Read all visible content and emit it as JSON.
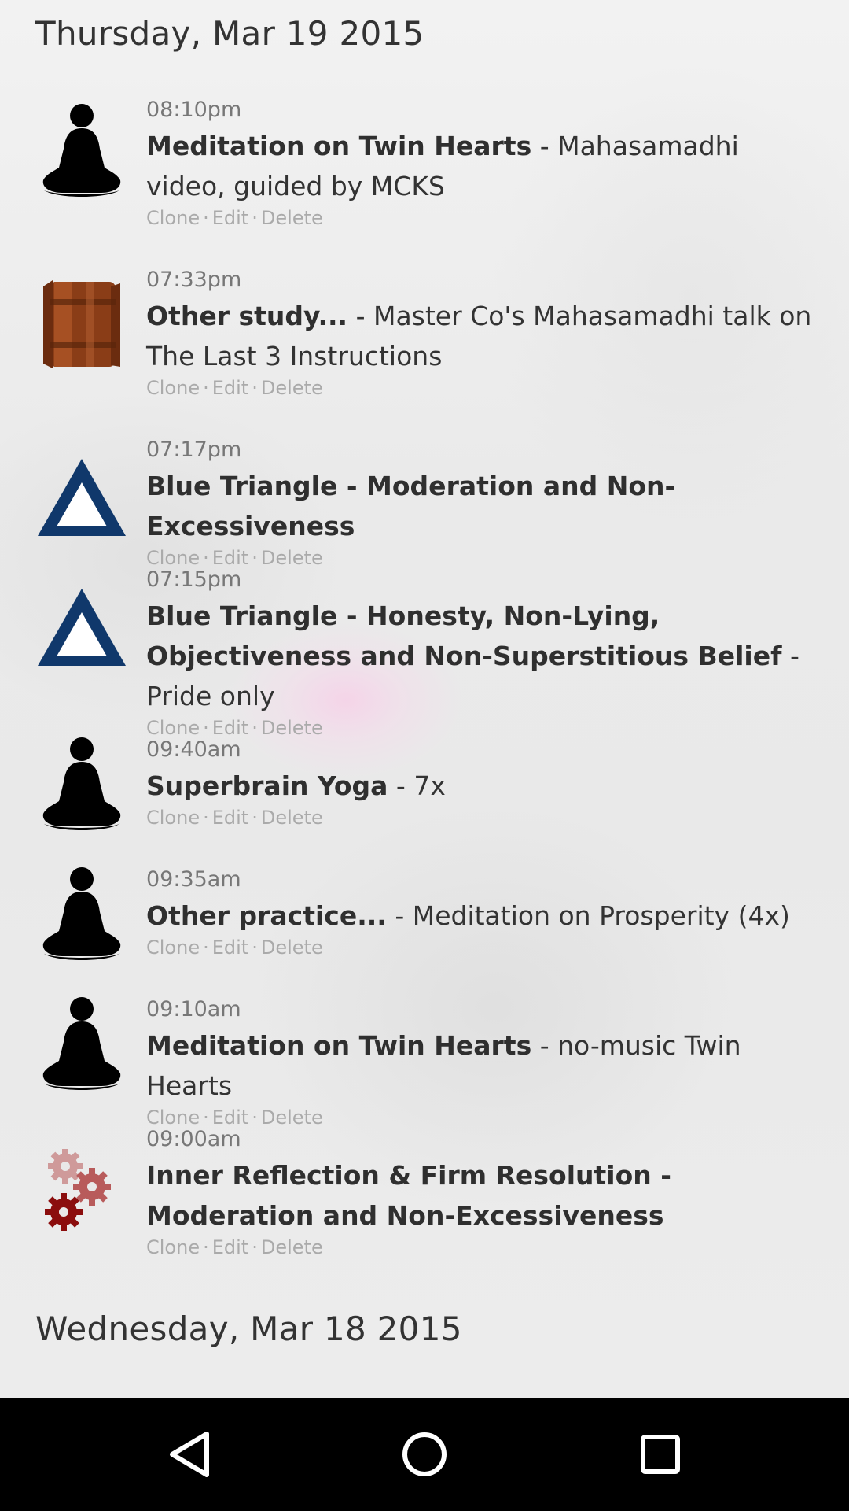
{
  "days": [
    {
      "label": "Thursday, Mar 19 2015"
    },
    {
      "label": "Wednesday, Mar 18 2015"
    }
  ],
  "entries": [
    {
      "time": "08:10pm",
      "name": "Meditation on Twin Hearts",
      "detail": " - Mahasamadhi video, guided by MCKS",
      "icon": "meditation-figure-icon"
    },
    {
      "time": "07:33pm",
      "name": "Other study...",
      "detail": " - Master Co's Mahasamadhi talk on The Last 3 Instructions",
      "icon": "book-scroll-icon"
    },
    {
      "time": "07:17pm",
      "name": "Blue Triangle - Moderation and Non-Excessiveness",
      "detail": "",
      "icon": "blue-triangle-icon"
    },
    {
      "time": "07:15pm",
      "name": "Blue Triangle - Honesty, Non-Lying, Objectiveness and Non-Superstitious Belief",
      "detail": " - Pride only",
      "icon": "blue-triangle-icon"
    },
    {
      "time": "09:40am",
      "name": "Superbrain Yoga",
      "detail": " - 7x",
      "icon": "meditation-figure-icon"
    },
    {
      "time": "09:35am",
      "name": "Other practice...",
      "detail": " - Meditation on Prosperity (4x)",
      "icon": "meditation-figure-icon"
    },
    {
      "time": "09:10am",
      "name": "Meditation on Twin Hearts",
      "detail": " - no-music Twin Hearts",
      "icon": "meditation-figure-icon"
    },
    {
      "time": "09:00am",
      "name": "Inner Reflection & Firm Resolution - Moderation and Non-Excessiveness",
      "detail": "",
      "icon": "gears-icon"
    }
  ],
  "actions": {
    "clone": "Clone",
    "edit": "Edit",
    "delete": "Delete",
    "separator": "·"
  },
  "navbar": {
    "back": "back-icon",
    "home": "home-icon",
    "recents": "recents-icon"
  },
  "colors": {
    "triangle": "#10386b",
    "book": "#8a3d17",
    "gear_dark": "#8b0d0d",
    "gear_light": "#cf9a9a",
    "gear_mid": "#b85b5b"
  }
}
